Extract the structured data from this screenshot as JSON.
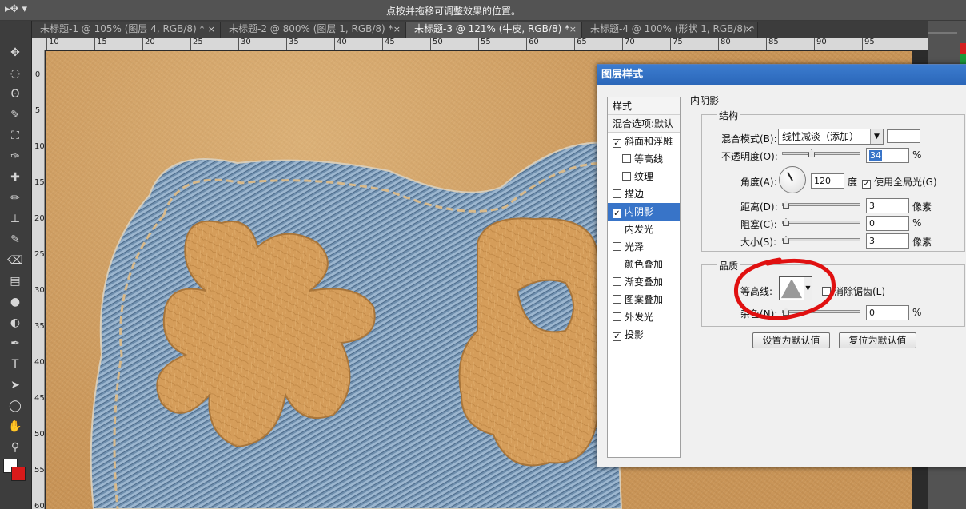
{
  "options_bar": {
    "hint": "点按并拖移可调整效果的位置。"
  },
  "tabs": [
    {
      "label": "未标题-1 @ 105% (图层 4, RGB/8) *",
      "close": "×",
      "active": false
    },
    {
      "label": "未标题-2 @ 800% (图层 1, RGB/8) *",
      "close": "×",
      "active": false
    },
    {
      "label": "未标题-3 @ 121% (牛皮, RGB/8) *",
      "close": "×",
      "active": true
    },
    {
      "label": "未标题-4 @ 100% (形状 1, RGB/8) *",
      "close": "×",
      "active": false
    }
  ],
  "ruler_top": [
    "10",
    "15",
    "20",
    "25",
    "30",
    "35",
    "40",
    "45",
    "50",
    "55",
    "60",
    "65",
    "70",
    "75",
    "80",
    "85",
    "90",
    "95"
  ],
  "ruler_left": [
    "0",
    "5",
    "10",
    "15",
    "20",
    "25",
    "30",
    "35",
    "40",
    "45",
    "50",
    "55",
    "60"
  ],
  "tools": [
    "move-tool-icon",
    "marquee-tool-icon",
    "lasso-tool-icon",
    "quick-select-tool-icon",
    "crop-tool-icon",
    "eyedropper-tool-icon",
    "healing-brush-icon",
    "brush-tool-icon",
    "clone-stamp-icon",
    "history-brush-icon",
    "eraser-tool-icon",
    "gradient-tool-icon",
    "blur-tool-icon",
    "dodge-tool-icon",
    "pen-tool-icon",
    "type-tool-icon",
    "path-select-icon",
    "ellipse-tool-icon",
    "hand-tool-icon",
    "zoom-tool-icon"
  ],
  "dialog": {
    "title": "图层样式",
    "styles_header": "样式",
    "blend_options": "混合选项:默认",
    "styles": [
      {
        "label": "斜面和浮雕",
        "checked": true,
        "sub": false,
        "selected": false
      },
      {
        "label": "等高线",
        "checked": false,
        "sub": true,
        "selected": false
      },
      {
        "label": "纹理",
        "checked": false,
        "sub": true,
        "selected": false
      },
      {
        "label": "描边",
        "checked": false,
        "sub": false,
        "selected": false
      },
      {
        "label": "内阴影",
        "checked": true,
        "sub": false,
        "selected": true
      },
      {
        "label": "内发光",
        "checked": false,
        "sub": false,
        "selected": false
      },
      {
        "label": "光泽",
        "checked": false,
        "sub": false,
        "selected": false
      },
      {
        "label": "颜色叠加",
        "checked": false,
        "sub": false,
        "selected": false
      },
      {
        "label": "渐变叠加",
        "checked": false,
        "sub": false,
        "selected": false
      },
      {
        "label": "图案叠加",
        "checked": false,
        "sub": false,
        "selected": false
      },
      {
        "label": "外发光",
        "checked": false,
        "sub": false,
        "selected": false
      },
      {
        "label": "投影",
        "checked": true,
        "sub": false,
        "selected": false
      }
    ],
    "section_title": "内阴影",
    "structure": {
      "legend": "结构",
      "blend_mode_label": "混合模式(B):",
      "blend_mode_value": "线性减淡（添加）",
      "opacity_label": "不透明度(O):",
      "opacity_value": "34",
      "opacity_unit": "%",
      "opacity_fraction": 0.34,
      "angle_label": "角度(A):",
      "angle_value": "120",
      "angle_unit": "度",
      "global_light_label": "使用全局光(G)",
      "global_light_checked": true,
      "distance_label": "距离(D):",
      "distance_value": "3",
      "distance_unit": "像素",
      "choke_label": "阻塞(C):",
      "choke_value": "0",
      "choke_unit": "%",
      "size_label": "大小(S):",
      "size_value": "3",
      "size_unit": "像素"
    },
    "quality": {
      "legend": "品质",
      "contour_label": "等高线:",
      "antialias_label": "消除锯齿(L)",
      "antialias_checked": false,
      "noise_label": "杂色(N):",
      "noise_value": "0",
      "noise_unit": "%"
    },
    "buttons": {
      "make_default": "设置为默认值",
      "reset_default": "复位为默认值"
    }
  },
  "colors": {
    "foreground": "#ffffff",
    "background": "#d81a1a",
    "annotation": "#e01010",
    "selection": "#3874c8"
  }
}
